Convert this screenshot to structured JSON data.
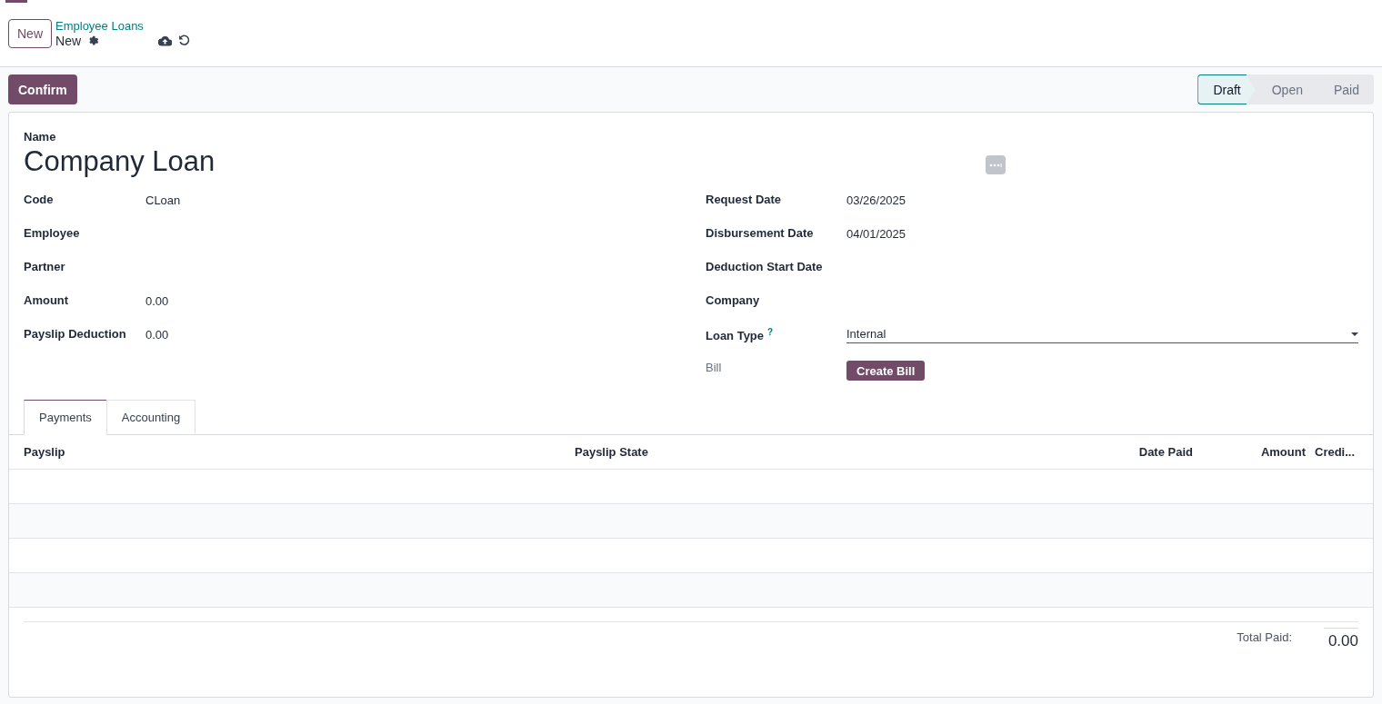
{
  "control_panel": {
    "new_button": "New",
    "parent": "Employee Loans",
    "current": "New"
  },
  "confirm_button": "Confirm",
  "statusbar": [
    {
      "label": "Draft",
      "selected": true
    },
    {
      "label": "Open",
      "selected": false
    },
    {
      "label": "Paid",
      "selected": false
    }
  ],
  "title": {
    "label": "Name",
    "value": "Company Loan"
  },
  "left_fields": [
    {
      "label": "Code",
      "value": "CLoan",
      "kind": "text"
    },
    {
      "label": "Employee",
      "kind": "text"
    },
    {
      "label": "Partner",
      "kind": "text"
    },
    {
      "label": "Amount",
      "value": "0.00",
      "kind": "text"
    },
    {
      "label": "Payslip Deduction",
      "value": "0.00",
      "kind": "text"
    }
  ],
  "right_fields": [
    {
      "label": "Request Date",
      "value": "03/26/2025",
      "kind": "text"
    },
    {
      "label": "Disbursement Date",
      "value": "04/01/2025",
      "kind": "text"
    },
    {
      "label": "Deduction Start Date",
      "kind": "text"
    },
    {
      "label": "Company",
      "kind": "text"
    },
    {
      "label": "Loan Type",
      "help": "?",
      "value": "Internal",
      "kind": "select"
    },
    {
      "label": "Bill",
      "button": "Create Bill",
      "kind": "button"
    }
  ],
  "tabs": [
    {
      "label": "Payments",
      "selected": true
    },
    {
      "label": "Accounting",
      "selected": false
    }
  ],
  "table": {
    "columns": [
      "Payslip",
      "Payslip State",
      "Date Paid",
      "Amount",
      "Credi..."
    ]
  },
  "total": {
    "label": "Total Paid:",
    "value": "0.00"
  }
}
